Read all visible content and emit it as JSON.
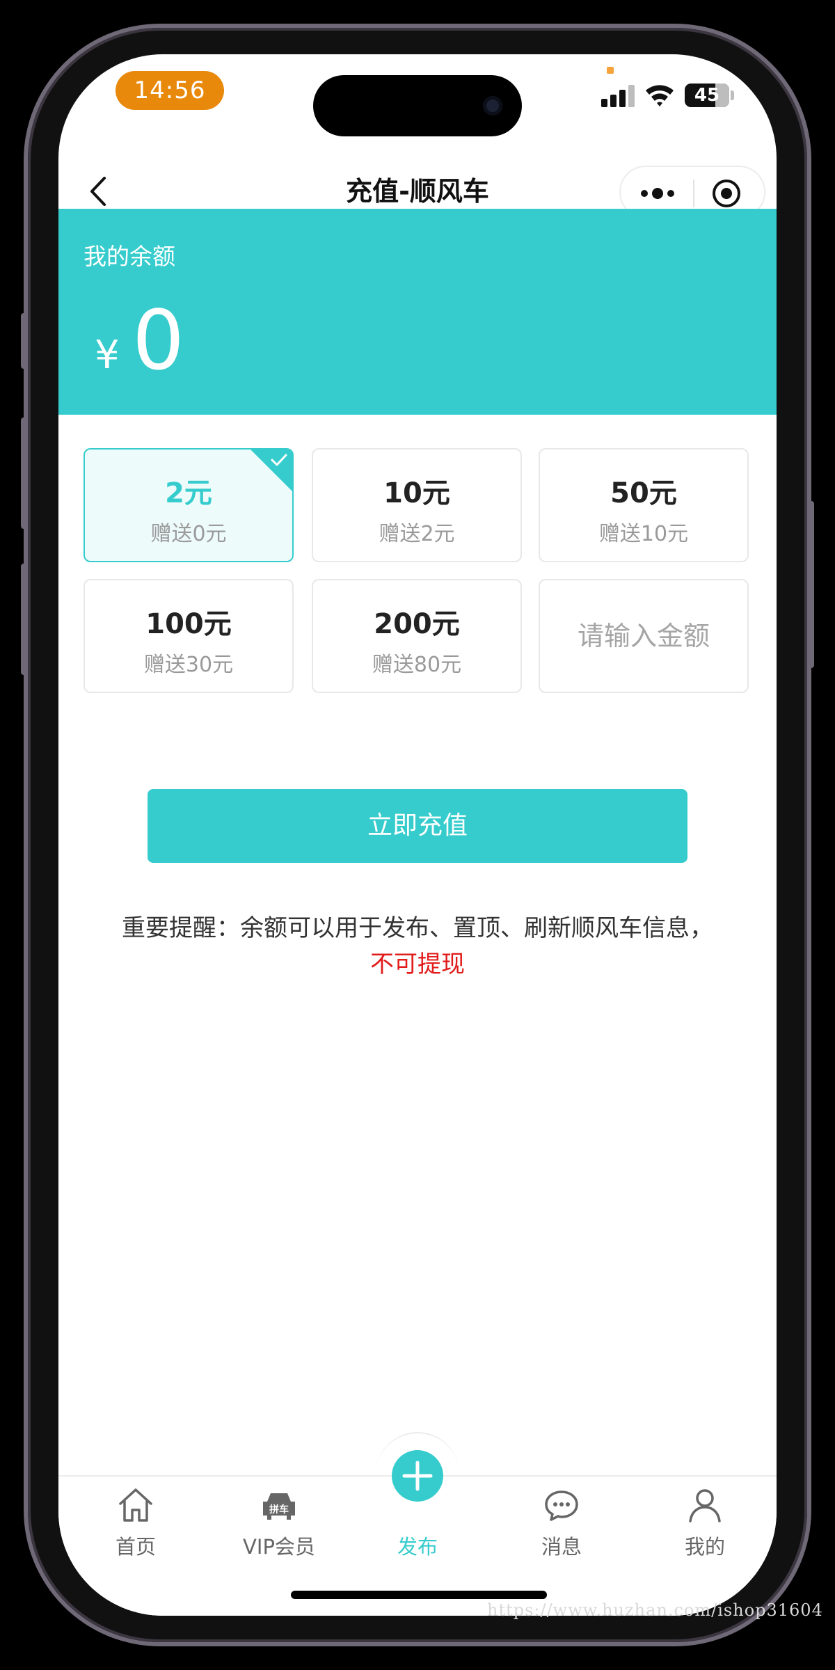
{
  "status_bar": {
    "time": "14:56",
    "battery": "45"
  },
  "header": {
    "title": "充值-顺风车",
    "back_icon": "chevron-left-icon",
    "more_icon": "more-dots-icon",
    "close_icon": "target-icon"
  },
  "balance": {
    "label": "我的余额",
    "currency": "¥",
    "amount": "0"
  },
  "options": [
    {
      "amount": "2元",
      "bonus": "赠送0元",
      "selected": true
    },
    {
      "amount": "10元",
      "bonus": "赠送2元",
      "selected": false
    },
    {
      "amount": "50元",
      "bonus": "赠送10元",
      "selected": false
    },
    {
      "amount": "100元",
      "bonus": "赠送30元",
      "selected": false
    },
    {
      "amount": "200元",
      "bonus": "赠送80元",
      "selected": false
    }
  ],
  "custom_amount": {
    "placeholder": "请输入金额"
  },
  "action": {
    "recharge_label": "立即充值"
  },
  "notice": {
    "text": "重要提醒：余额可以用于发布、置顶、刷新顺风车信息，",
    "warning": "不可提现"
  },
  "tab_bar": {
    "items": [
      {
        "label": "首页",
        "icon": "home-icon",
        "active": false
      },
      {
        "label": "VIP会员",
        "icon": "car-icon",
        "icon_text": "拼车",
        "active": false
      },
      {
        "label": "发布",
        "icon": "plus-icon",
        "active": true
      },
      {
        "label": "消息",
        "icon": "chat-icon",
        "active": false
      },
      {
        "label": "我的",
        "icon": "user-icon",
        "active": false
      }
    ]
  },
  "watermark": "https://www.huzhan.com/ishop31604",
  "colors": {
    "accent": "#36cccd",
    "warning": "#e21b1b",
    "time_pill": "#e8890c"
  }
}
